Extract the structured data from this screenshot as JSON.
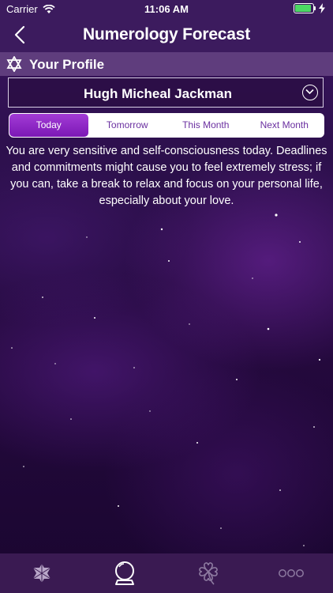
{
  "status_bar": {
    "carrier": "Carrier",
    "time": "11:06 AM"
  },
  "nav": {
    "title": "Numerology Forecast",
    "back_icon": "chevron-left-icon"
  },
  "profile": {
    "label": "Your Profile",
    "icon": "star-of-david-icon"
  },
  "selector": {
    "name": "Hugh Micheal Jackman",
    "icon": "chevron-down-circle-icon"
  },
  "segments": [
    {
      "label": "Today",
      "active": true
    },
    {
      "label": "Tomorrow",
      "active": false
    },
    {
      "label": "This Month",
      "active": false
    },
    {
      "label": "Next Month",
      "active": false
    }
  ],
  "forecast": {
    "text": "You are very sensitive and self-consciousness today. Deadlines and commitments might cause you to feel extremely stress; if you can, take a break to relax and focus on your personal life, especially about your love."
  },
  "tab_bar": {
    "items": [
      {
        "icon": "hexagram-icon",
        "active": false
      },
      {
        "icon": "crystal-ball-icon",
        "active": true
      },
      {
        "icon": "four-leaf-clover-icon",
        "active": false
      },
      {
        "icon": "more-icon",
        "active": false
      }
    ]
  },
  "colors": {
    "accent": "#8a24c4",
    "battery": "#4cd964",
    "bar": "#3c1b5e"
  }
}
